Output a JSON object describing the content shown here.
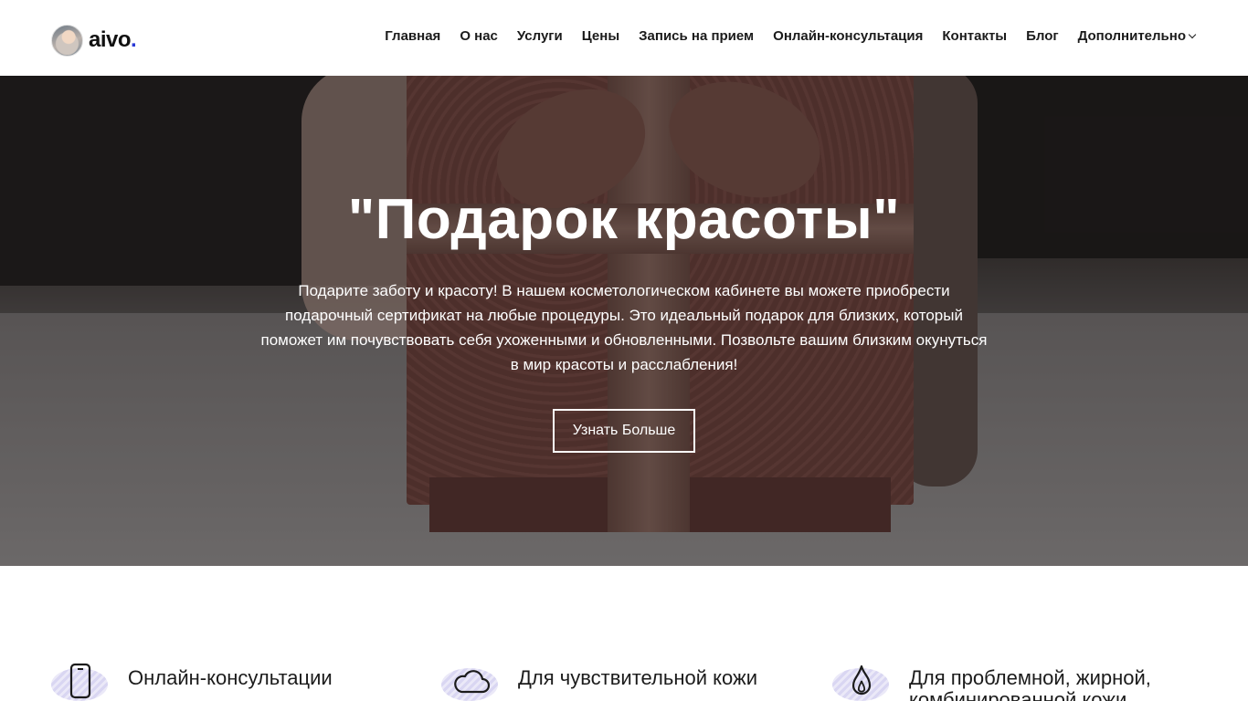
{
  "logo": {
    "text": "aivo",
    "dot": "."
  },
  "nav": {
    "items": [
      "Главная",
      "О нас",
      "Услуги",
      "Цены",
      "Запись на прием",
      "Онлайн-консультация",
      "Контакты",
      "Блог",
      "Дополнительно"
    ]
  },
  "hero": {
    "title": "\"Подарок красоты\"",
    "text": "Подарите заботу и красоту! В нашем косметологическом кабинете вы можете приобрести подарочный сертификат на любые процедуры. Это идеальный подарок для близких, который поможет им почувствовать себя ухоженными и обновленными. Позвольте вашим близким окунуться в мир красоты и расслабления!",
    "button_label": "Узнать Больше"
  },
  "features": [
    {
      "icon": "phone-icon",
      "title": "Онлайн-консультации"
    },
    {
      "icon": "cloud-icon",
      "title": "Для чувствительной кожи"
    },
    {
      "icon": "flame-icon",
      "title": "Для проблемной, жирной, комбинированной кожи"
    }
  ],
  "colors": {
    "accent": "#2a3ad6",
    "text": "#1b1b1b",
    "icon_blob": "#d9d6f2"
  }
}
